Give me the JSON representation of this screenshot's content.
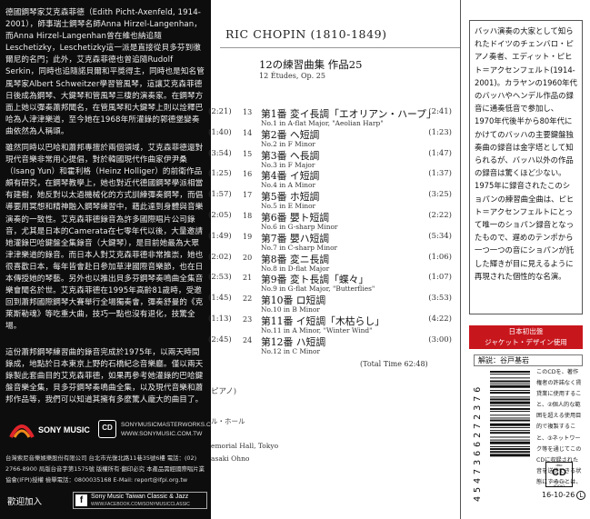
{
  "sleeve": {
    "para1": "德國鋼琴家艾克森菲德（Edith Picht-Axenfeld, 1914-2001），師事瑞士鋼琴名師Anna Hirzel-Langenhan，而Anna Hirzel-Langenhan曾在維也納追隨Leschetizky，Leschetizky這一派是直接從貝多芬到徹爾尼的名門；此外，艾克森菲德也曾追隨Rudolf Serkin，同時也追隨諾貝爾和平獎得主，同時也是知名管風琴家Albert Schweitzer學習管風琴，這讓艾克森菲德日後成為鋼琴、大鍵琴和管風琴三棲的演奏家。在鋼琴方面上她以彈奏蕭邦聞名，在管風琴和大鍵琴上則以詮釋巴哈為人津津樂道，至今她在1968年所灌錄的郭德堡變奏曲依然為人稱頌。",
    "para2": "雖然同時以巴哈和蕭邦專擅於兩個領域，艾克森菲德還對現代音樂非常用心提倡，對於韓國現代作曲家伊尹桑（Isang Yun）和霍利格（Heinz Holliger）的前衛作品頗有研究，在鋼琴教學上，她也對近代德國鋼琴學派相當有建樹，她反對以太過機械化的方式訓練彈奏鋼琴，而倡導要用冥想和精神融入鋼琴練習中，藉此達到身體與音樂演奏的一致性。艾克森菲德錄音為許多國際唱片公司錄音，尤其是日本的Camerata在七零年代以後，大量邀請她灌錄巴哈鍵盤全集錄音（大鍵琴），是目前她最為大眾津津樂道的錄音。而日本人對艾克森菲德非常推崇，她也很喜歡日本，每年皆會赴日參加草津國際音樂節，也在日本傳授她的琴藝。另外也以推出貝多芬鋼琴奏鳴曲全集音樂會聞名於世。艾克森菲德在1995年高齡81歲時，受邀回到蕭邦國際鋼琴大賽舉行全場獨奏會，彈奏舒曼的《克萊斯勒魂》等吃重大曲，技巧一點也沒有退化，技驚全場。",
    "para3": "這份蕭邦鋼琴練習曲的錄音完成於1975年，以兩天時間錄成，地點於日本東京上野的石橋紀念音樂廳。僅以兩天錄製此套曲目的艾克森菲德，如果再參考她灌錄的巴哈鍵盤音樂全集，貝多芬鋼琴奏鳴曲全集，以及現代音樂和蕭邦作品等，我們可以知道其擁有多麼驚人龐大的曲目了。",
    "sony_label": "SONY MUSIC",
    "cd_logo": "CD",
    "url1": "SONYMUSICMASTERWORKS.COM",
    "url2": "WWW.SONYMUSIC.COM.TW",
    "company": "台灣索尼音樂娛樂股份有限公司 台北市光復北路11巷35號6樓 電話：(02) 2766-8900 局版台音字第1575號 版權所有·翻印必究 本產品需經國際唱片業協會(IFPI)授權 檢舉電話：0800035168 E-Mail: report@ifpi.org.tw",
    "welcome": "歡迎加入",
    "fb_label": "Sony Music Taiwan Classic & Jazz",
    "fb_url": "WWW.FACEBOOK.COM/SONYMUSICCLASSIC"
  },
  "middle": {
    "composer": "RIC CHOPIN (1810-1849)",
    "ghost_times": [
      "(2:21)",
      "(1:40)",
      "(3:54)",
      "(1:25)",
      "(1:57)",
      "(2:05)",
      "(1:49)",
      "(2:02)",
      "(2:53)",
      "(1:45)",
      "(1:13)",
      "(2:45)"
    ],
    "album_title": "12の練習曲集 作品25",
    "album_sub": "12 Études, Op. 25",
    "tracks": [
      {
        "num": "13",
        "jp": "第1番 変イ長調「エオリアン・ハープ」",
        "en": "No.1 in A-flat Major, \"Aeolian Harp\"",
        "dur": "(2:41)"
      },
      {
        "num": "14",
        "jp": "第2番 ヘ短調",
        "en": "No.2 in F Minor",
        "dur": "(1:23)"
      },
      {
        "num": "15",
        "jp": "第3番 ヘ長調",
        "en": "No.3 in F Major",
        "dur": "(1:47)"
      },
      {
        "num": "16",
        "jp": "第4番 イ短調",
        "en": "No.4 in A Minor",
        "dur": "(1:37)"
      },
      {
        "num": "17",
        "jp": "第5番 ホ短調",
        "en": "No.5 in E Minor",
        "dur": "(3:25)"
      },
      {
        "num": "18",
        "jp": "第6番 嬰ト短調",
        "en": "No.6 in G-sharp Minor",
        "dur": "(2:22)"
      },
      {
        "num": "19",
        "jp": "第7番 嬰ハ短調",
        "en": "No.7 in C-sharp Minor",
        "dur": "(5:34)"
      },
      {
        "num": "20",
        "jp": "第8番 変ニ長調",
        "en": "No.8 in D-flat Major",
        "dur": "(1:06)"
      },
      {
        "num": "21",
        "jp": "第9番 変ト長調「蝶々」",
        "en": "No.9 in G-flat Major, \"Butterflies\"",
        "dur": "(1:07)"
      },
      {
        "num": "22",
        "jp": "第10番 ロ短調",
        "en": "No.10 in B Minor",
        "dur": "(3:53)"
      },
      {
        "num": "23",
        "jp": "第11番 イ短調「木枯らし」",
        "en": "No.11 in A Minor, \"Winter Wind\"",
        "dur": "(4:22)"
      },
      {
        "num": "24",
        "jp": "第12番 ハ短調",
        "en": "No.12 in C Minor",
        "dur": "(3:00)"
      }
    ],
    "total": "(Total Time 62:48)",
    "ghost1": "ピアノ)",
    "ghost2": "ル・ホール",
    "ghost3": "emorial Hall, Tokyo",
    "ghost4": "asaki Ohno"
  },
  "right": {
    "jp_text": "バッハ演奏の大家として知られたドイツのチェンバロ・ピアノ奏者、エディット・ピヒト＝アクセンフェルト(1914-2001)。カラヤンの1960年代のバッハやヘンデル作品の録音に通奏低音で参加し、1970年代後半から80年代にかけてのバッハの主要鍵盤独奏曲の録音は金字塔として知られるが、バッハ以外の作品の録音は驚くほど少ない。1975年に録音されたこのショパンの練習曲全曲は、ピヒト＝アクセンフェルトにとって唯一のショパン録音となったもので、遅めのテンポから一つ一つの音にショパンが託した輝きが目に見えるように再現された個性的な名演。",
    "banner_line1": "日本初出盤",
    "banner_line2": "ジャケット・デザイン使用",
    "comment": "解説：谷戸基岩",
    "notice": "このCDを、著作権者の許諾なく賃貸業に使用すること、②個人的な範囲を超える使用目的で複製すること、③ネットワーク等を通じてこのCDに収録された音を送信できる状態にすることは、",
    "barcode_digits": "4547366272376",
    "cd_da_top": "disc",
    "cd_da_main": "CD",
    "cd_da_bottom": "DIGITAL AUDIO",
    "catalog": "16-10-26",
    "l_mark": "L"
  }
}
